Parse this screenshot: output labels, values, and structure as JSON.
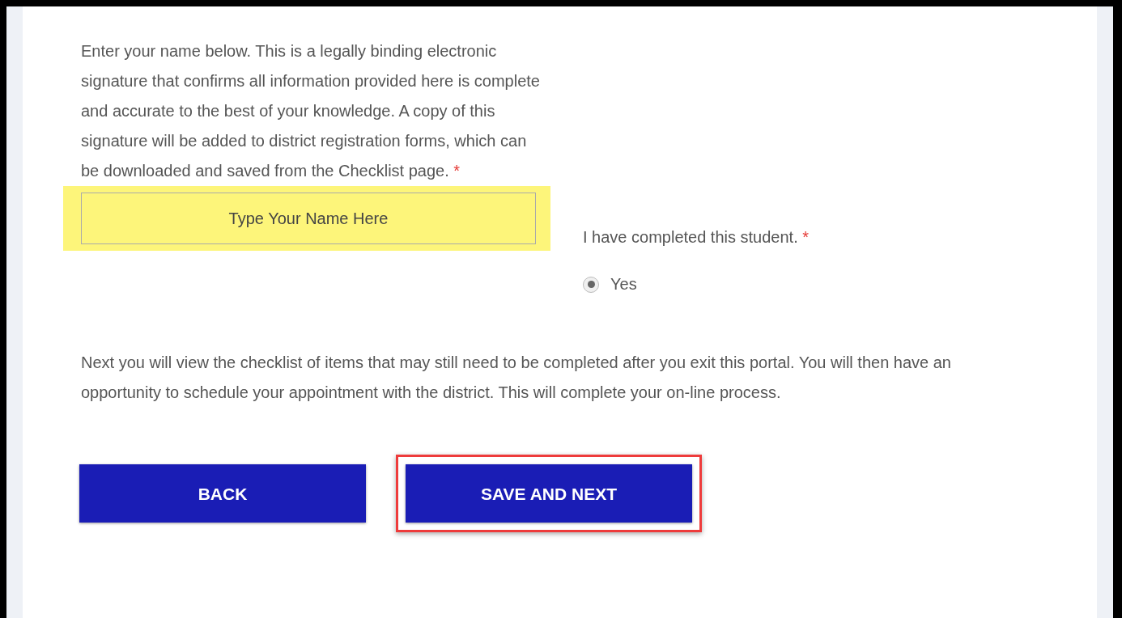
{
  "signature": {
    "prompt": "Enter your name below. This is a legally binding electronic signature that confirms all information provided here is complete and accurate to the best of your knowledge. A copy of this signature will be added to district registration forms, which can be downloaded and saved from the Checklist page.",
    "required_mark": "*",
    "placeholder": "Type Your Name Here",
    "highlighted": true
  },
  "completion": {
    "label": "I have completed this student.",
    "required_mark": "*",
    "options": [
      {
        "label": "Yes",
        "selected": true
      }
    ]
  },
  "note": "Next you will view the checklist of items that may still need to be completed after you exit this portal. You will then have an opportunity to schedule your appointment with the district. This will complete your on-line process.",
  "buttons": [
    {
      "label": "BACK",
      "highlighted": false
    },
    {
      "label": "SAVE AND NEXT",
      "highlighted": true
    }
  ]
}
